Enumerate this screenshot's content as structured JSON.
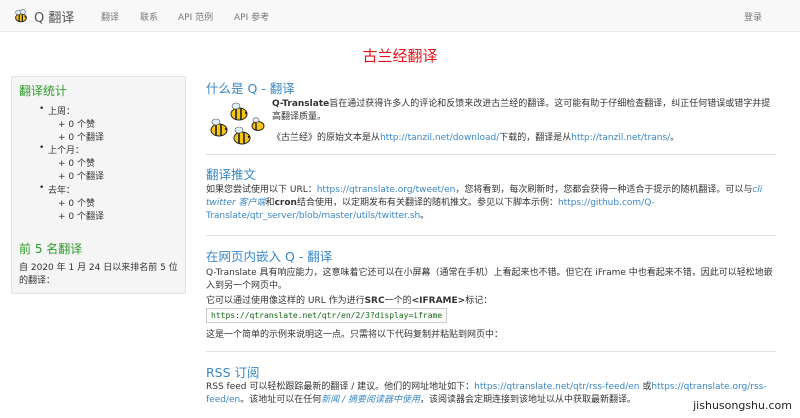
{
  "nav": {
    "brand": "Q 翻译",
    "links": [
      "翻译",
      "联系",
      "API 范例",
      "API 参考"
    ],
    "login": "登录"
  },
  "page_title": "古兰经翻译",
  "sidebar": {
    "stats_title": "翻译统计",
    "periods": [
      {
        "label": "上周：",
        "lines": [
          "+ 0 个赞",
          "+ 0 个翻译"
        ]
      },
      {
        "label": "上个月：",
        "lines": [
          "+ 0 个赞",
          "+ 0 个翻译"
        ]
      },
      {
        "label": "去年：",
        "lines": [
          "+ 0 个赞",
          "+ 0 个翻译"
        ]
      }
    ],
    "top_title": "前 5 名翻译",
    "top_note": "自 2020 年 1 月 24 日以来排名前 5 位的翻译："
  },
  "sections": {
    "what": {
      "title": "什么是 Q - 翻译",
      "p1_bold": "Q-Translate",
      "p1_rest": "旨在通过获得许多人的评论和反馈来改进古兰经的翻译。这可能有助于仔细检查翻译，纠正任何错误或错字并提高翻译质量。",
      "p2_a": "《古兰经》的原始文本是从",
      "p2_link1": "http://tanzil.net/download/",
      "p2_b": "下载的，翻译是从",
      "p2_link2": "http://tanzil.net/trans/",
      "p2_c": "。"
    },
    "tweet": {
      "title": "翻译推文",
      "p_a": "如果您尝试使用以下 URL：",
      "p_link1": "https://qtranslate.org/tweet/en",
      "p_b": "，您将看到，每次刷新时，您都会获得一种适合于提示的随机翻译。可以与",
      "p_em": "cli twitter 客户端",
      "p_c": "和",
      "p_bold": "cron",
      "p_d": "结合使用，以定期发布有关翻译的随机推文。参见以下脚本示例：",
      "p_link2": "https://github.com/Q-Translate/qtr_server/blob/master/utils/twitter.sh",
      "p_e": "。"
    },
    "embed": {
      "title": "在网页内嵌入 Q - 翻译",
      "p1": "Q-Translate 具有响应能力，这意味着它还可以在小屏幕（通常在手机）上看起来也不错。但它在 iFrame 中也看起来不错，因此可以轻松地嵌入到另一个网页中。",
      "p2_a": "它可以通过使用像这样的 URL 作为进行",
      "p2_b": "SRC",
      "p2_c": "一个的",
      "p2_d": "<IFRAME>",
      "p2_e": "标记：",
      "code": "https://qtranslate.net/qtr/en/2/3?display=iframe",
      "p3": "这是一个简单的示例来说明这一点。只需将以下代码复制并粘贴到网页中："
    },
    "rss": {
      "title": "RSS 订阅",
      "p_a": "RSS feed 可以轻松跟踪最新的翻译 / 建议。他们的网址地址如下：",
      "p_link1": "https://qtranslate.net/qtr/rss-feed/en",
      "p_b": " 或",
      "p_link2": "https://qtranslate.org/rss-feed/en",
      "p_c": "。该地址可以在任何",
      "p_em": "新闻 / 摘要阅读器中使用",
      "p_d": "，该阅读器会定期连接到该地址以从中获取最新翻译。"
    }
  },
  "watermark": "jishusongshu.com",
  "colors": {
    "title_red": "#e0161a",
    "link_blue": "#3a87c4",
    "sidebar_green": "#2e9b2b"
  }
}
